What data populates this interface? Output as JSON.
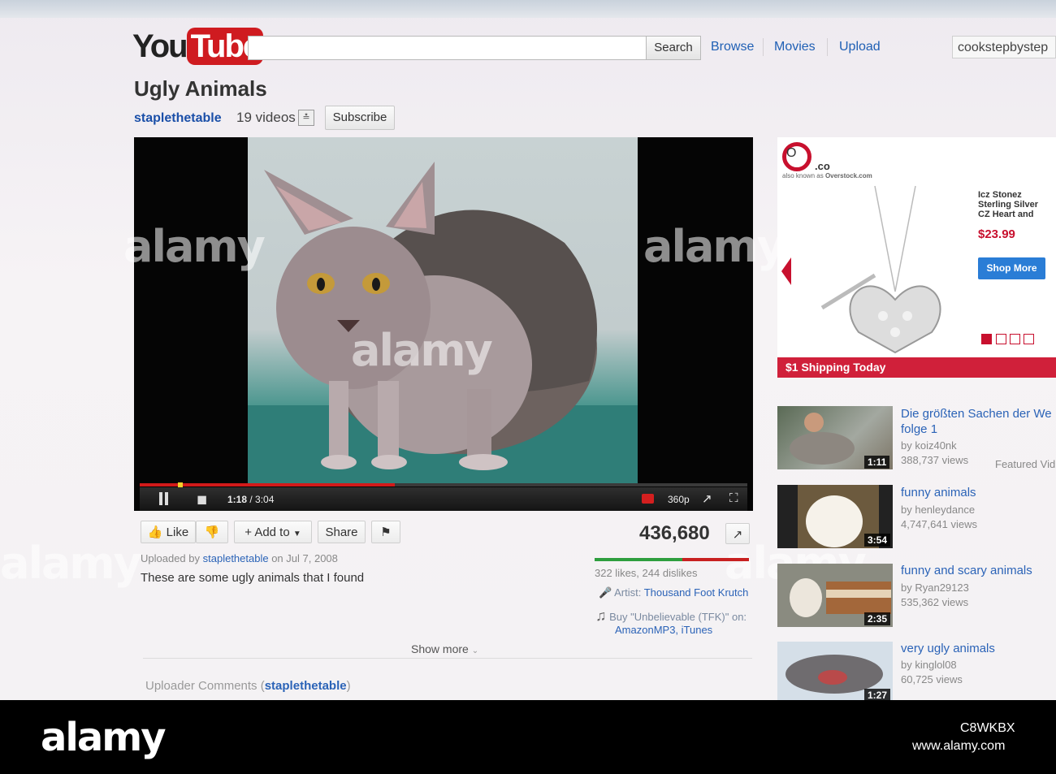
{
  "header": {
    "logo_you": "You",
    "logo_tube": "Tube",
    "search_button": "Search",
    "nav": [
      "Browse",
      "Movies",
      "Upload"
    ],
    "username": "cookstepbystep"
  },
  "video": {
    "title": "Ugly Animals",
    "channel": "staplethetable",
    "video_count": "19 videos",
    "subscribe_label": "Subscribe",
    "time_current": "1:18",
    "time_total": "3:04",
    "progress_fraction": 0.42,
    "quality": "360p"
  },
  "actions": {
    "like": "Like",
    "add_to": "Add to",
    "share": "Share",
    "view_count": "436,680",
    "likes_summary": "322 likes, 244 dislikes",
    "like_ratio": 0.57
  },
  "details": {
    "uploaded_prefix": "Uploaded by",
    "uploader": "staplethetable",
    "uploaded_on": "on Jul 7, 2008",
    "description": "These are some ugly animals that I found",
    "artist_label": "Artist:",
    "artist": "Thousand Foot Krutch",
    "buy_prefix": "Buy \"Unbelievable (TFK)\" on:",
    "buy_stores": "AmazonMP3, iTunes",
    "show_more": "Show more",
    "uploader_comments_label": "Uploader Comments (",
    "uploader_comments_user": "staplethetable",
    "uploader_comments_close": ")"
  },
  "ad": {
    "brand_mark": "O",
    "brand_co": ".co",
    "brand_sub": "also known as",
    "brand_name": "Overstock.com",
    "product_line1": "Icz Stonez",
    "product_line2": "Sterling Silver",
    "product_line3": "CZ Heart and",
    "price": "$23.99",
    "cta": "Shop More",
    "footer": "$1 Shipping Today"
  },
  "related": [
    {
      "title": "Die größten Sachen der We",
      "title2": "folge 1",
      "by": "by koiz40nk",
      "views": "388,737 views",
      "duration": "1:11",
      "extra": "Featured Vid"
    },
    {
      "title": "funny animals",
      "by": "by henleydance",
      "views": "4,747,641 views",
      "duration": "3:54"
    },
    {
      "title": "funny and scary animals",
      "by": "by Ryan29123",
      "views": "535,362 views",
      "duration": "2:35"
    },
    {
      "title": "very ugly animals",
      "by": "by kinglol08",
      "views": "60,725 views",
      "duration": "1:27"
    }
  ],
  "watermark": {
    "text": "alamy",
    "stock_id": "C8WKBX",
    "url": "www.alamy.com"
  },
  "colors": {
    "link": "#2b63b7",
    "youtube_red": "#cf1b20",
    "ad_red": "#d0203a",
    "like_green": "#2e9e3e",
    "dislike_red": "#c82020"
  }
}
